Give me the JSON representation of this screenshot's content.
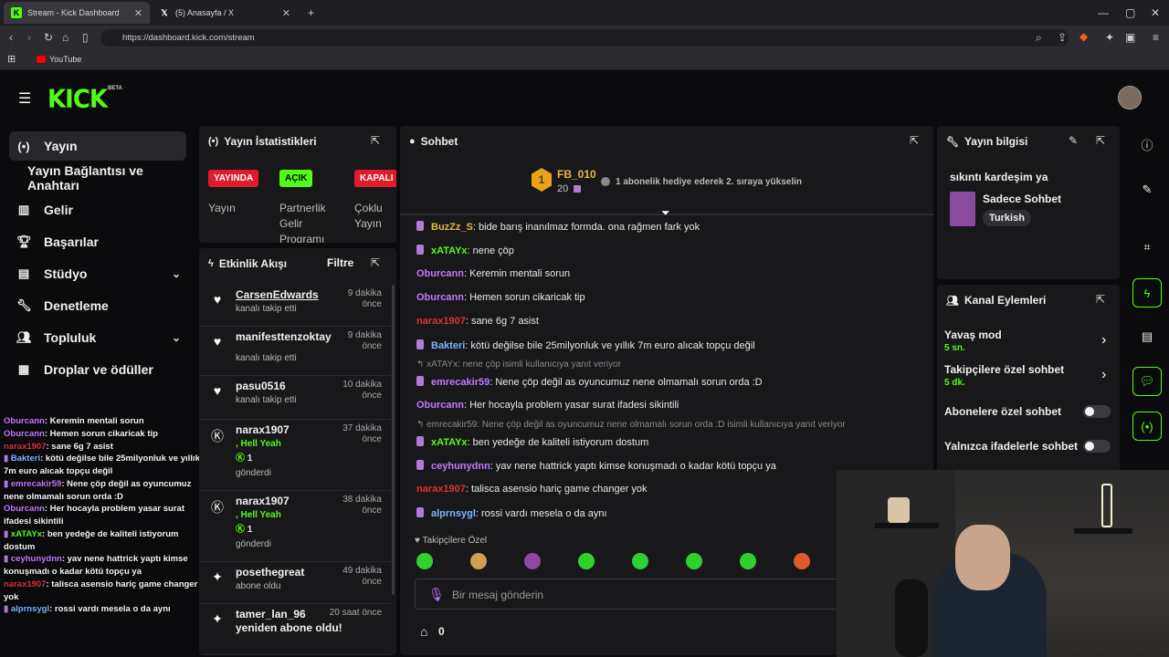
{
  "browser": {
    "tabs": [
      {
        "title": "Stream - Kick Dashboard",
        "favicon": "kick-icon"
      },
      {
        "title": "(5) Anasayfa / X",
        "favicon": "x-icon"
      }
    ],
    "url": "https://dashboard.kick.com/stream",
    "bookmark": "YouTube"
  },
  "header": {
    "logo": "KICK",
    "beta": "BETA"
  },
  "sidebar": {
    "items": [
      {
        "label": "Yayın",
        "icon": "broadcast-icon"
      },
      {
        "label": "Yayın Bağlantısı ve Anahtarı",
        "icon": ""
      },
      {
        "label": "Gelir",
        "icon": "chart-icon"
      },
      {
        "label": "Başarılar",
        "icon": "trophy-icon"
      },
      {
        "label": "Stüdyo",
        "icon": "studio-icon"
      },
      {
        "label": "Denetleme",
        "icon": "wrench-icon"
      },
      {
        "label": "Topluluk",
        "icon": "people-icon"
      },
      {
        "label": "Droplar ve ödüller",
        "icon": "drops-icon"
      }
    ]
  },
  "overlay_chat": [
    {
      "user": "Oburcann",
      "color": "#c07aff",
      "text": ": Keremin mentali sorun",
      "badge": false
    },
    {
      "user": "Oburcann",
      "color": "#c07aff",
      "text": ": Hemen sorun cikaricak tip",
      "badge": false
    },
    {
      "user": "narax1907",
      "color": "#e0303a",
      "text": ": sane 6g 7 asist",
      "badge": false
    },
    {
      "user": "Bakteri",
      "color": "#7fb2ff",
      "text": ": kötü değilse bile 25milyonluk ve yıllık 7m euro alıcak topçu değil",
      "badge": true
    },
    {
      "user": "emrecakir59",
      "color": "#c07aff",
      "text": ": Nene çöp değil as oyuncumuz nene olmamalı sorun orda :D",
      "badge": true
    },
    {
      "user": "Oburcann",
      "color": "#c07aff",
      "text": ": Her hocayla problem yasar surat ifadesi sikintili",
      "badge": false
    },
    {
      "user": "xATAYx",
      "color": "#53fc18",
      "text": ": ben yedeğe de kaliteli istiyorum dostum",
      "badge": true
    },
    {
      "user": "ceyhunydnn",
      "color": "#c07aff",
      "text": ": yav nene hattrick yaptı kimse konuşmadı o kadar kötü topçu ya",
      "badge": true
    },
    {
      "user": "narax1907",
      "color": "#e0303a",
      "text": ": talisca asensio hariç game changer yok",
      "badge": false
    },
    {
      "user": "alprnsygl",
      "color": "#7fb2ff",
      "text": ": rossi vardı mesela o da aynı",
      "badge": true
    }
  ],
  "stats_panel": {
    "title": "Yayın İstatistikleri",
    "statuses": [
      {
        "badge": "YAYINDA",
        "label": "Yayın",
        "color": "#e01b2b"
      },
      {
        "badge": "AÇIK",
        "label": "Partnerlik Gelir Programı",
        "color": "#53fc18"
      },
      {
        "badge": "KAPALI",
        "label": "Çoklu Yayın",
        "color": "#e01b2b"
      }
    ]
  },
  "activity_panel": {
    "title": "Etkinlik Akışı",
    "filter": "Filtre",
    "items": [
      {
        "name": "CarsenEdwards",
        "time": "9 dakika önce",
        "sub": "kanalı takip etti",
        "icon": "heart-icon"
      },
      {
        "name": "manifesttenzoktay",
        "time": "9 dakika önce",
        "sub": "kanalı takip etti",
        "icon": "heart-icon"
      },
      {
        "name": "pasu0516",
        "time": "10 dakika önce",
        "sub": "kanalı takip etti",
        "icon": "heart-icon"
      },
      {
        "name": "narax1907",
        "time": "37 dakika önce",
        "sub1": ", Hell Yeah",
        "sub2": "1",
        "sub3": "gönderdi",
        "icon": "kick-coin-icon"
      },
      {
        "name": "narax1907",
        "time": "38 dakika önce",
        "sub1": ", Hell Yeah",
        "sub2": "1",
        "sub3": "gönderdi",
        "icon": "kick-coin-icon"
      },
      {
        "name": "posethegreat",
        "time": "49 dakika önce",
        "sub": "abone oldu",
        "icon": "sparkle-icon"
      },
      {
        "name": "tamer_lan_96 yeniden abone oldu!",
        "time": "20 saat önce",
        "sub": "",
        "icon": "sparkle-icon"
      }
    ]
  },
  "chat_panel": {
    "title": "Sohbet",
    "leader": {
      "rank": "1",
      "name": "FB_010",
      "count": "20"
    },
    "gift_hint": "1 abonelik hediye ederek 2. sıraya yükselin",
    "messages": [
      {
        "user": "BuzZz_S",
        "color": "#e8b84a",
        "text": ": bide barış inanılmaz formda. ona rağmen fark yok",
        "badge": true
      },
      {
        "user": "xATAYx",
        "color": "#53fc18",
        "text": ": nene çöp",
        "badge": true
      },
      {
        "user": "Oburcann",
        "color": "#c07aff",
        "text": ": Keremin mentali sorun",
        "badge": false
      },
      {
        "user": "Oburcann",
        "color": "#c07aff",
        "text": ": Hemen sorun cikaricak tip",
        "badge": false
      },
      {
        "user": "narax1907",
        "color": "#e0303a",
        "text": ": sane 6g 7 asist",
        "badge": false
      },
      {
        "user": "Bakteri",
        "color": "#7fb2ff",
        "text": ": kötü değilse bile 25milyonluk ve yıllık 7m euro alıcak topçu değil",
        "badge": true
      },
      {
        "user": "emrecakir59",
        "color": "#c07aff",
        "text": ": Nene çöp değil as oyuncumuz nene olmamalı sorun orda :D",
        "badge": true,
        "reply": "xATAYx: nene çöp isimli kullanıcıya yanıt veriyor"
      },
      {
        "user": "Oburcann",
        "color": "#c07aff",
        "text": ": Her hocayla problem yasar surat ifadesi sikintili",
        "badge": false
      },
      {
        "user": "xATAYx",
        "color": "#53fc18",
        "text": ": ben yedeğe de kaliteli istiyorum dostum",
        "badge": true,
        "reply": "emrecakir59: Nene çöp değil as oyuncumuz nene olmamalı sorun orda :D isimli kullanıcıya yanıt veriyor"
      },
      {
        "user": "ceyhunydnn",
        "color": "#c07aff",
        "text": ": yav nene hattrick yaptı kimse konuşmadı o kadar kötü topçu ya",
        "badge": true
      },
      {
        "user": "narax1907",
        "color": "#e0303a",
        "text": ": talisca asensio hariç game changer yok",
        "badge": false
      },
      {
        "user": "alprnsygl",
        "color": "#7fb2ff",
        "text": ": rossi vardı mesela o da aynı",
        "badge": true
      }
    ],
    "emote_section": "Takipçilere Özel",
    "input_placeholder": "Bir mesaj gönderin",
    "gift_count": "0"
  },
  "info_panel": {
    "title": "Yayın bilgisi",
    "stream_title": "sıkıntı kardeşim ya",
    "category": "Sadece Sohbet",
    "language": "Turkish"
  },
  "actions_panel": {
    "title": "Kanal Eylemleri",
    "slow_mode": "Yavaş mod",
    "slow_value": "5 sn.",
    "followers_only": "Takipçilere özel sohbet",
    "followers_value": "5 dk.",
    "subs_only": "Abonelere özel sohbet",
    "emotes_only": "Yalnızca ifadelerle sohbet"
  }
}
